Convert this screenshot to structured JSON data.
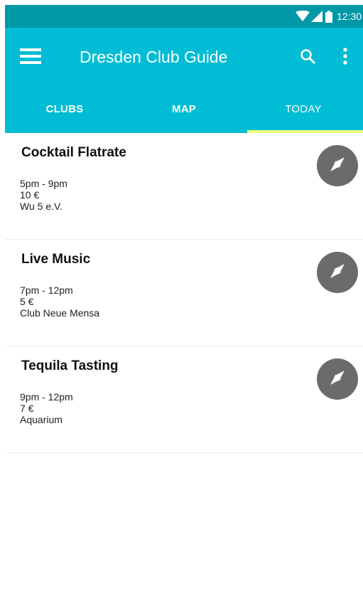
{
  "status_bar": {
    "time": "12:30",
    "icons": [
      "wifi-icon",
      "signal-icon",
      "battery-icon"
    ],
    "color": "#0097a7"
  },
  "toolbar": {
    "title": "Dresden Club Guide",
    "menu_icon": "menu-icon",
    "search_icon": "search-icon",
    "more_icon": "more-vert-icon",
    "color": "#00bcd4"
  },
  "tabs": [
    {
      "label": "CLUBS",
      "selected": false
    },
    {
      "label": "MAP",
      "selected": false
    },
    {
      "label": "TODAY",
      "selected": true
    }
  ],
  "tab_indicator_color": "#f4ff81",
  "events": [
    {
      "title": "Cocktail Flatrate",
      "time": "5pm - 9pm",
      "price": "10 €",
      "location": "Wu 5 e.V.",
      "action_icon": "compass-icon"
    },
    {
      "title": "Live Music",
      "time": "7pm - 12pm",
      "price": "5 €",
      "location": "Club Neue Mensa",
      "action_icon": "compass-icon"
    },
    {
      "title": "Tequila Tasting",
      "time": "9pm - 12pm",
      "price": "7 €",
      "location": "Aquarium",
      "action_icon": "compass-icon"
    }
  ]
}
